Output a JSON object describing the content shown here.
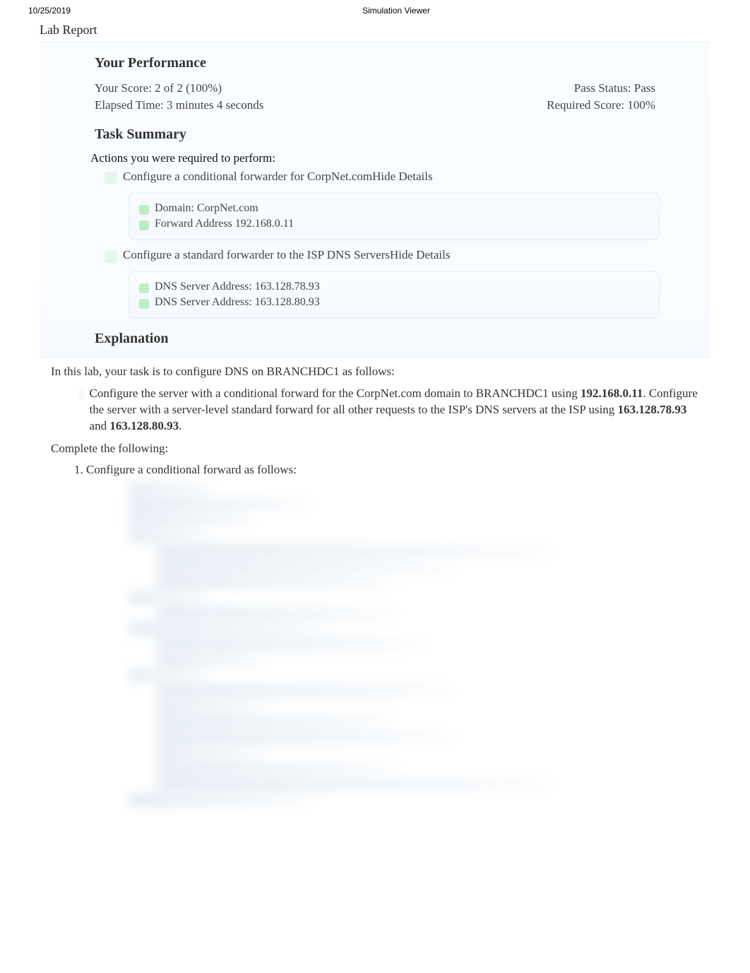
{
  "header": {
    "date": "10/25/2019",
    "app_title": "Simulation Viewer"
  },
  "lab_report_label": "Lab Report",
  "performance": {
    "heading": "Your Performance",
    "score_label": "Your Score: 2 of 2 (100%)",
    "pass_label": "Pass Status: Pass",
    "elapsed_label": "Elapsed Time: 3 minutes 4 seconds",
    "required_label": "Required Score: 100%"
  },
  "task_summary": {
    "heading": "Task Summary",
    "actions_label": "Actions you were required to perform:",
    "tasks": [
      {
        "text": "Configure a conditional forwarder for CorpNet.com",
        "toggle": "Hide Details",
        "details": [
          "Domain: CorpNet.com",
          "Forward Address 192.168.0.11"
        ]
      },
      {
        "text": "Configure a standard forwarder to the ISP DNS Servers",
        "toggle": "Hide Details",
        "details": [
          "DNS Server Address: 163.128.78.93",
          "DNS Server Address: 163.128.80.93"
        ]
      }
    ]
  },
  "explanation": {
    "heading": "Explanation",
    "intro": "In this lab, your task is to configure DNS on BRANCHDC1 as follows:",
    "bullet_pre": "Configure the server with a conditional forward for the CorpNet.com domain to BRANCHDC1 using ",
    "ip1": "192.168.0.11",
    "bullet_mid": ". Configure the server with a server-level standard forward for all other requests to the ISP's DNS servers at the ISP using ",
    "ip2": "163.128.78.93",
    "and": " and ",
    "ip3": "163.128.80.93",
    "period": ".",
    "complete_label": "Complete the following:",
    "step1": "Configure a conditional forward as follows:"
  }
}
